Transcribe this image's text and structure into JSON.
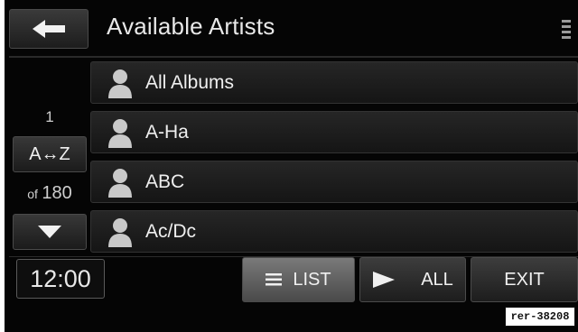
{
  "header": {
    "title": "Available Artists",
    "back_icon": "left-arrow-icon",
    "settings_icon": "settings-icon"
  },
  "sidebar": {
    "page_current": "1",
    "sort_label": "A↔Z",
    "page_of": "of",
    "page_total": "180",
    "scroll_down_icon": "down-triangle-icon"
  },
  "list": {
    "items": [
      {
        "label": "All Albums",
        "icon": "person-icon"
      },
      {
        "label": "A-Ha",
        "icon": "person-icon"
      },
      {
        "label": "ABC",
        "icon": "person-icon"
      },
      {
        "label": "Ac/Dc",
        "icon": "person-icon"
      }
    ]
  },
  "footer": {
    "clock": "12:00",
    "list_label": "LIST",
    "all_label": "ALL",
    "exit_label": "EXIT"
  },
  "watermark": "rer-38208",
  "colors": {
    "background": "#050505",
    "button": "#2a2a2a",
    "active_button": "#6a6a6a",
    "text": "#efefef"
  }
}
